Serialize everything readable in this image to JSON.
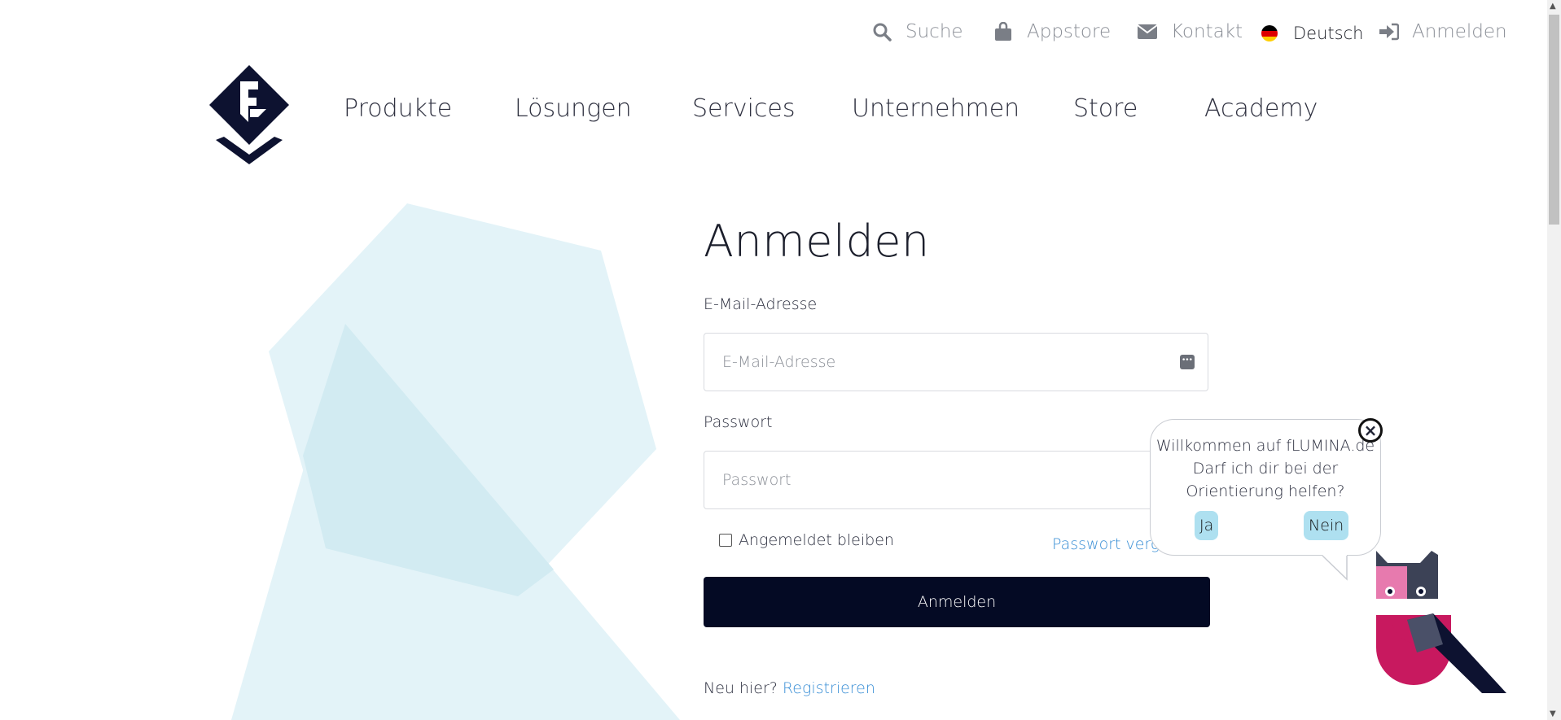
{
  "topbar": {
    "search_label": "Suche",
    "appstore_label": "Appstore",
    "contact_label": "Kontakt",
    "language_label": "Deutsch",
    "login_label": "Anmelden"
  },
  "nav": {
    "items": [
      {
        "label": "Produkte"
      },
      {
        "label": "Lösungen"
      },
      {
        "label": "Services"
      },
      {
        "label": "Unternehmen"
      },
      {
        "label": "Store"
      },
      {
        "label": "Academy"
      }
    ]
  },
  "login": {
    "title": "Anmelden",
    "email_label": "E-Mail-Adresse",
    "email_placeholder": "E-Mail-Adresse",
    "password_label": "Passwort",
    "password_placeholder": "Passwort",
    "remember_label": "Angemeldet bleiben",
    "forgot_label": "Passwort verge",
    "submit_label": "Anmelden",
    "new_here": "Neu hier?",
    "register_label": "Registrieren"
  },
  "assistant": {
    "line1": "Willkommen auf fLUMINA.de",
    "line2": "Darf ich dir bei der",
    "line3": "Orientierung helfen?",
    "yes_label": "Ja",
    "no_label": "Nein"
  },
  "colors": {
    "primary_dark": "#040a24",
    "link_blue": "#3a8fd6",
    "shape_light": "#e3f3f8",
    "bubble_button": "#aee0f0",
    "owl_magenta": "#c8195f",
    "owl_pink": "#e77aae"
  }
}
